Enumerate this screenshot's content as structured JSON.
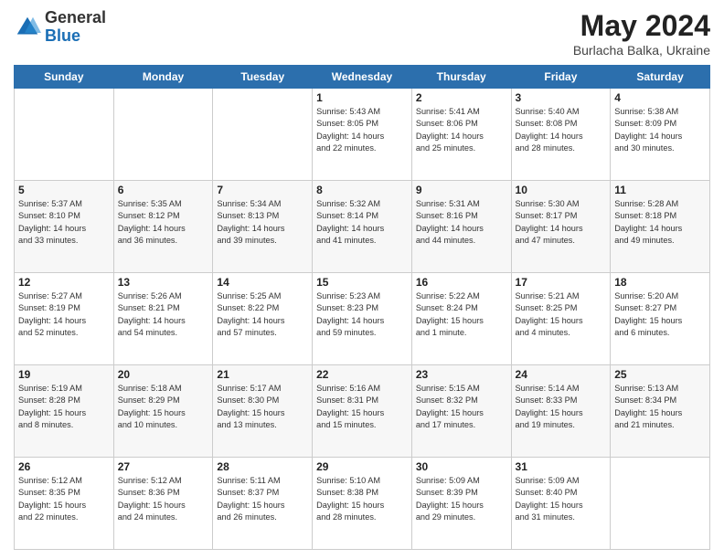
{
  "header": {
    "logo_general": "General",
    "logo_blue": "Blue",
    "main_title": "May 2024",
    "subtitle": "Burlacha Balka, Ukraine"
  },
  "calendar": {
    "days_of_week": [
      "Sunday",
      "Monday",
      "Tuesday",
      "Wednesday",
      "Thursday",
      "Friday",
      "Saturday"
    ],
    "weeks": [
      [
        {
          "day": "",
          "info": ""
        },
        {
          "day": "",
          "info": ""
        },
        {
          "day": "",
          "info": ""
        },
        {
          "day": "1",
          "info": "Sunrise: 5:43 AM\nSunset: 8:05 PM\nDaylight: 14 hours\nand 22 minutes."
        },
        {
          "day": "2",
          "info": "Sunrise: 5:41 AM\nSunset: 8:06 PM\nDaylight: 14 hours\nand 25 minutes."
        },
        {
          "day": "3",
          "info": "Sunrise: 5:40 AM\nSunset: 8:08 PM\nDaylight: 14 hours\nand 28 minutes."
        },
        {
          "day": "4",
          "info": "Sunrise: 5:38 AM\nSunset: 8:09 PM\nDaylight: 14 hours\nand 30 minutes."
        }
      ],
      [
        {
          "day": "5",
          "info": "Sunrise: 5:37 AM\nSunset: 8:10 PM\nDaylight: 14 hours\nand 33 minutes."
        },
        {
          "day": "6",
          "info": "Sunrise: 5:35 AM\nSunset: 8:12 PM\nDaylight: 14 hours\nand 36 minutes."
        },
        {
          "day": "7",
          "info": "Sunrise: 5:34 AM\nSunset: 8:13 PM\nDaylight: 14 hours\nand 39 minutes."
        },
        {
          "day": "8",
          "info": "Sunrise: 5:32 AM\nSunset: 8:14 PM\nDaylight: 14 hours\nand 41 minutes."
        },
        {
          "day": "9",
          "info": "Sunrise: 5:31 AM\nSunset: 8:16 PM\nDaylight: 14 hours\nand 44 minutes."
        },
        {
          "day": "10",
          "info": "Sunrise: 5:30 AM\nSunset: 8:17 PM\nDaylight: 14 hours\nand 47 minutes."
        },
        {
          "day": "11",
          "info": "Sunrise: 5:28 AM\nSunset: 8:18 PM\nDaylight: 14 hours\nand 49 minutes."
        }
      ],
      [
        {
          "day": "12",
          "info": "Sunrise: 5:27 AM\nSunset: 8:19 PM\nDaylight: 14 hours\nand 52 minutes."
        },
        {
          "day": "13",
          "info": "Sunrise: 5:26 AM\nSunset: 8:21 PM\nDaylight: 14 hours\nand 54 minutes."
        },
        {
          "day": "14",
          "info": "Sunrise: 5:25 AM\nSunset: 8:22 PM\nDaylight: 14 hours\nand 57 minutes."
        },
        {
          "day": "15",
          "info": "Sunrise: 5:23 AM\nSunset: 8:23 PM\nDaylight: 14 hours\nand 59 minutes."
        },
        {
          "day": "16",
          "info": "Sunrise: 5:22 AM\nSunset: 8:24 PM\nDaylight: 15 hours\nand 1 minute."
        },
        {
          "day": "17",
          "info": "Sunrise: 5:21 AM\nSunset: 8:25 PM\nDaylight: 15 hours\nand 4 minutes."
        },
        {
          "day": "18",
          "info": "Sunrise: 5:20 AM\nSunset: 8:27 PM\nDaylight: 15 hours\nand 6 minutes."
        }
      ],
      [
        {
          "day": "19",
          "info": "Sunrise: 5:19 AM\nSunset: 8:28 PM\nDaylight: 15 hours\nand 8 minutes."
        },
        {
          "day": "20",
          "info": "Sunrise: 5:18 AM\nSunset: 8:29 PM\nDaylight: 15 hours\nand 10 minutes."
        },
        {
          "day": "21",
          "info": "Sunrise: 5:17 AM\nSunset: 8:30 PM\nDaylight: 15 hours\nand 13 minutes."
        },
        {
          "day": "22",
          "info": "Sunrise: 5:16 AM\nSunset: 8:31 PM\nDaylight: 15 hours\nand 15 minutes."
        },
        {
          "day": "23",
          "info": "Sunrise: 5:15 AM\nSunset: 8:32 PM\nDaylight: 15 hours\nand 17 minutes."
        },
        {
          "day": "24",
          "info": "Sunrise: 5:14 AM\nSunset: 8:33 PM\nDaylight: 15 hours\nand 19 minutes."
        },
        {
          "day": "25",
          "info": "Sunrise: 5:13 AM\nSunset: 8:34 PM\nDaylight: 15 hours\nand 21 minutes."
        }
      ],
      [
        {
          "day": "26",
          "info": "Sunrise: 5:12 AM\nSunset: 8:35 PM\nDaylight: 15 hours\nand 22 minutes."
        },
        {
          "day": "27",
          "info": "Sunrise: 5:12 AM\nSunset: 8:36 PM\nDaylight: 15 hours\nand 24 minutes."
        },
        {
          "day": "28",
          "info": "Sunrise: 5:11 AM\nSunset: 8:37 PM\nDaylight: 15 hours\nand 26 minutes."
        },
        {
          "day": "29",
          "info": "Sunrise: 5:10 AM\nSunset: 8:38 PM\nDaylight: 15 hours\nand 28 minutes."
        },
        {
          "day": "30",
          "info": "Sunrise: 5:09 AM\nSunset: 8:39 PM\nDaylight: 15 hours\nand 29 minutes."
        },
        {
          "day": "31",
          "info": "Sunrise: 5:09 AM\nSunset: 8:40 PM\nDaylight: 15 hours\nand 31 minutes."
        },
        {
          "day": "",
          "info": ""
        }
      ]
    ]
  }
}
